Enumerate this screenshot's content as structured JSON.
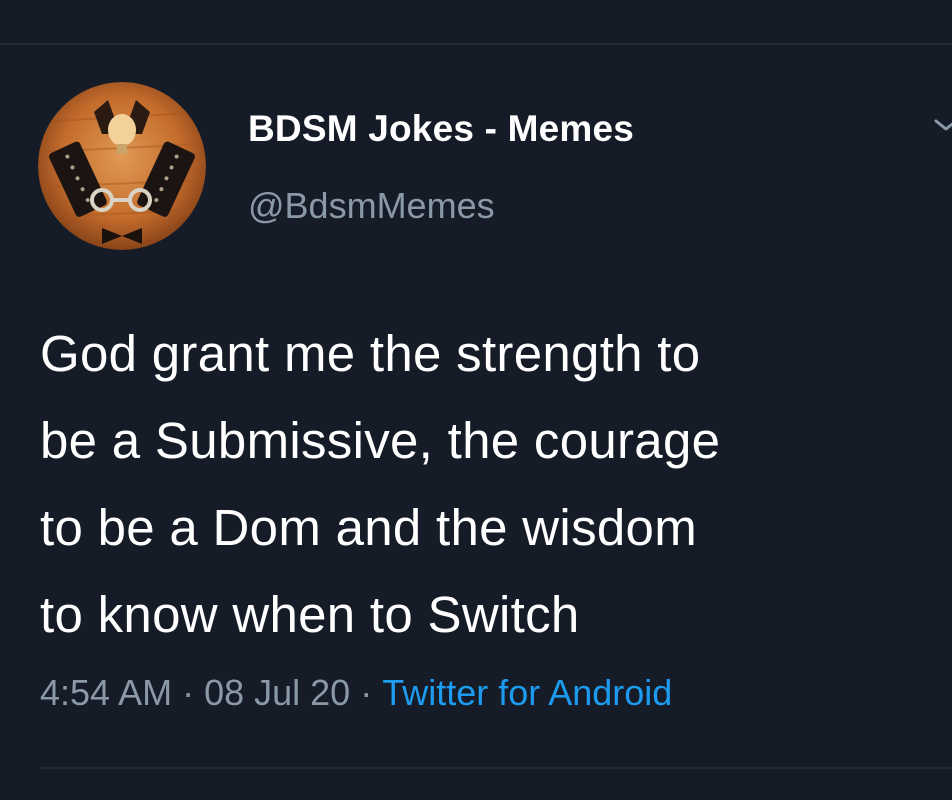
{
  "account": {
    "display_name": "BDSM Jokes - Memes",
    "handle": "@BdsmMemes"
  },
  "tweet": {
    "lines": [
      "God grant me the strength to",
      "be a Submissive, the courage",
      "to be a Dom and the wisdom",
      "to know when to Switch"
    ]
  },
  "meta": {
    "time": "4:54 AM",
    "separator": "·",
    "date": "08 Jul 20",
    "source": "Twitter for Android"
  },
  "icons": {
    "avatar": "avatar-image",
    "menu": "chevron-down-icon"
  },
  "colors": {
    "background": "#151c27",
    "text_primary": "#ffffff",
    "text_secondary": "#8b98a5",
    "link": "#1d9bf0"
  }
}
